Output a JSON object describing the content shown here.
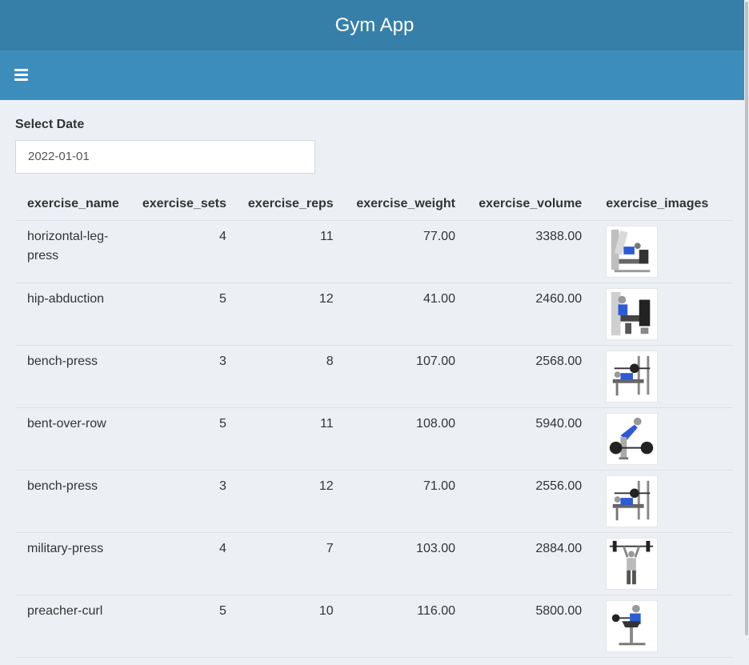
{
  "app": {
    "title": "Gym App"
  },
  "navbar": {
    "menu_icon": "hamburger-icon"
  },
  "date_filter": {
    "label": "Select Date",
    "value": "2022-01-01"
  },
  "table": {
    "columns": [
      "exercise_name",
      "exercise_sets",
      "exercise_reps",
      "exercise_weight",
      "exercise_volume",
      "exercise_images"
    ],
    "rows": [
      {
        "name": "horizontal-leg-press",
        "sets": "4",
        "reps": "11",
        "weight": "77.00",
        "volume": "3388.00",
        "image": "horizontal-leg-press-illustration"
      },
      {
        "name": "hip-abduction",
        "sets": "5",
        "reps": "12",
        "weight": "41.00",
        "volume": "2460.00",
        "image": "hip-abduction-illustration"
      },
      {
        "name": "bench-press",
        "sets": "3",
        "reps": "8",
        "weight": "107.00",
        "volume": "2568.00",
        "image": "bench-press-illustration"
      },
      {
        "name": "bent-over-row",
        "sets": "5",
        "reps": "11",
        "weight": "108.00",
        "volume": "5940.00",
        "image": "bent-over-row-illustration"
      },
      {
        "name": "bench-press",
        "sets": "3",
        "reps": "12",
        "weight": "71.00",
        "volume": "2556.00",
        "image": "bench-press-illustration"
      },
      {
        "name": "military-press",
        "sets": "4",
        "reps": "7",
        "weight": "103.00",
        "volume": "2884.00",
        "image": "military-press-illustration"
      },
      {
        "name": "preacher-curl",
        "sets": "5",
        "reps": "10",
        "weight": "116.00",
        "volume": "5800.00",
        "image": "preacher-curl-illustration"
      }
    ]
  },
  "colors": {
    "header": "#367fa9",
    "navbar": "#3c8dbc",
    "background": "#ecf0f5",
    "accent": "#2d5bd6"
  }
}
